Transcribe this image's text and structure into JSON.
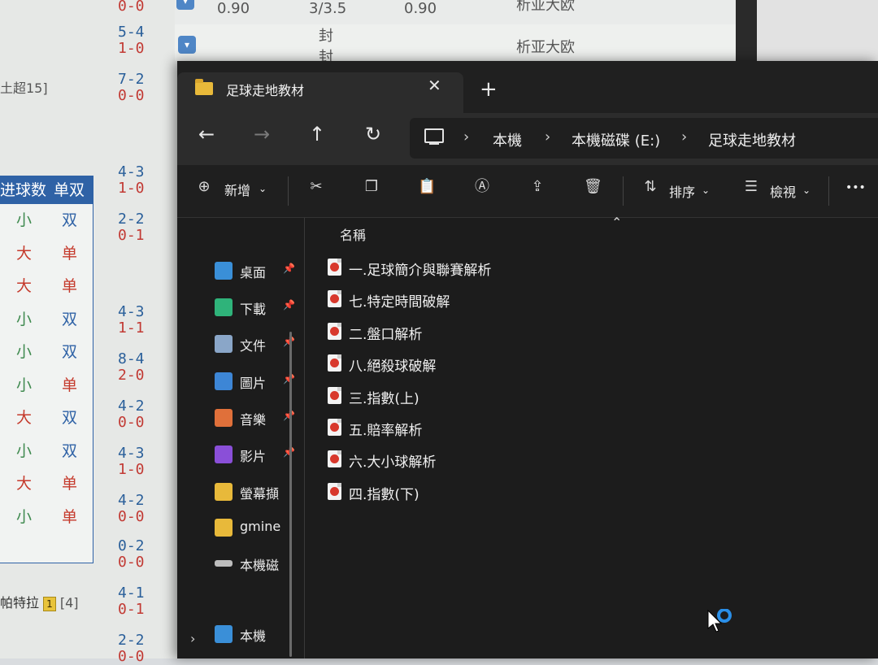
{
  "background": {
    "top_row": {
      "odds_left": "0.90",
      "handicap": "3/3.5",
      "odds_right": "0.90",
      "company": "析亚大欧"
    },
    "row2": {
      "handicap": "封",
      "handicap2": "封",
      "company": "析亚大欧"
    },
    "league_label": "土超15]",
    "scores": [
      {
        "a": "0-0",
        "b": ""
      },
      {
        "a": "5-4",
        "b": "1-0"
      },
      {
        "a": "7-2",
        "b": "0-0"
      },
      {
        "a": "4-3",
        "b": "1-0"
      },
      {
        "a": "2-2",
        "b": "0-1"
      },
      {
        "a": "4-3",
        "b": "1-1"
      },
      {
        "a": "8-4",
        "b": "2-0"
      },
      {
        "a": "4-2",
        "b": "0-0"
      },
      {
        "a": "4-3",
        "b": "1-0"
      },
      {
        "a": "4-2",
        "b": "0-0"
      },
      {
        "a": "0-2",
        "b": "0-0"
      },
      {
        "a": "4-1",
        "b": "0-1"
      },
      {
        "a": "2-2",
        "b": "0-0"
      }
    ],
    "table": {
      "headers": [
        "进球数",
        "单双"
      ],
      "rows": [
        [
          "小",
          "双"
        ],
        [
          "大",
          "单"
        ],
        [
          "大",
          "单"
        ],
        [
          "小",
          "双"
        ],
        [
          "小",
          "双"
        ],
        [
          "小",
          "单"
        ],
        [
          "大",
          "双"
        ],
        [
          "小",
          "双"
        ],
        [
          "大",
          "单"
        ],
        [
          "小",
          "单"
        ]
      ]
    },
    "team_label": "帕特拉",
    "team_badge": "1",
    "team_rank": "[4]"
  },
  "explorer": {
    "tab_title": "足球走地教材",
    "new_tab": "+",
    "breadcrumbs": [
      "本機",
      "本機磁碟 (E:)",
      "足球走地教材"
    ],
    "commands": {
      "new": "新增",
      "sort": "排序",
      "view": "檢視",
      "more": "•••"
    },
    "sidebar": [
      {
        "label": "桌面",
        "pinned": true,
        "icon": "desktop-icon",
        "color": "#3a8fd8"
      },
      {
        "label": "下載",
        "pinned": true,
        "icon": "download-icon",
        "color": "#2fb37a"
      },
      {
        "label": "文件",
        "pinned": true,
        "icon": "document-icon",
        "color": "#8aa6c8"
      },
      {
        "label": "圖片",
        "pinned": true,
        "icon": "pictures-icon",
        "color": "#3d86d6"
      },
      {
        "label": "音樂",
        "pinned": true,
        "icon": "music-icon",
        "color": "#e0703a"
      },
      {
        "label": "影片",
        "pinned": true,
        "icon": "video-icon",
        "color": "#8a4fd8"
      },
      {
        "label": "螢幕擷",
        "pinned": false,
        "icon": "folder-icon",
        "color": "#e8b93a"
      },
      {
        "label": "gmine",
        "pinned": false,
        "icon": "folder-icon",
        "color": "#e8b93a"
      },
      {
        "label": "本機磁",
        "pinned": false,
        "icon": "drive-icon",
        "color": "#bdbdbd"
      },
      {
        "label": "本機",
        "pinned": false,
        "icon": "pc-icon",
        "color": "#3a8fd8"
      }
    ],
    "column_header": "名稱",
    "files": [
      "一.足球簡介與聯賽解析",
      "七.特定時間破解",
      "二.盤口解析",
      "八.絕殺球破解",
      "三.指數(上)",
      "五.賠率解析",
      "六.大小球解析",
      "四.指數(下)"
    ]
  }
}
